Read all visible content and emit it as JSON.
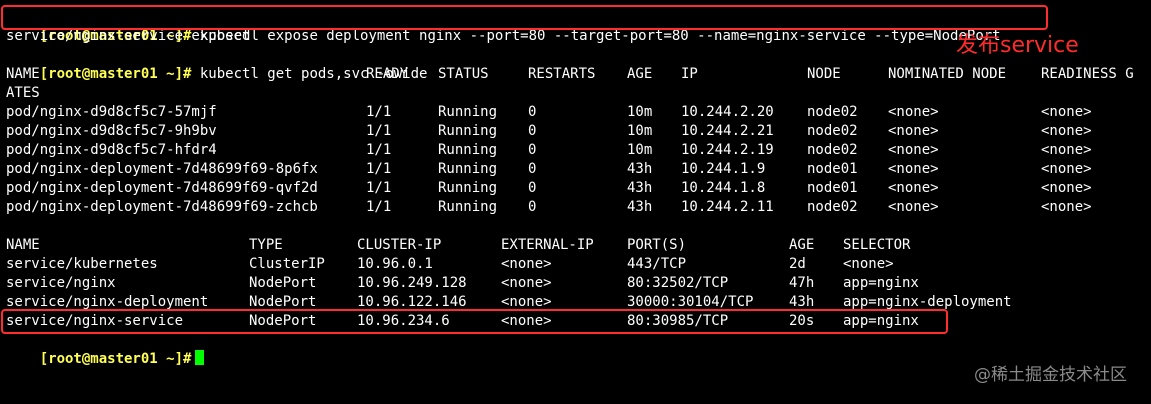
{
  "prompt": "[root@master01 ~]#",
  "commands": {
    "expose": "kubectl expose deployment nginx --port=80 --target-port=80 --name=nginx-service --type=NodePort",
    "get": "kubectl get pods,svc -owide"
  },
  "output": {
    "exposed": "service/nginx-service exposed",
    "ates": "ATES"
  },
  "pods": {
    "headers": [
      "NAME",
      "READY",
      "STATUS",
      "RESTARTS",
      "AGE",
      "IP",
      "NODE",
      "NOMINATED NODE",
      "READINESS G"
    ],
    "rows": [
      [
        "pod/nginx-d9d8cf5c7-57mjf",
        "1/1",
        "Running",
        "0",
        "10m",
        "10.244.2.20",
        "node02",
        "<none>",
        "<none>"
      ],
      [
        "pod/nginx-d9d8cf5c7-9h9bv",
        "1/1",
        "Running",
        "0",
        "10m",
        "10.244.2.21",
        "node02",
        "<none>",
        "<none>"
      ],
      [
        "pod/nginx-d9d8cf5c7-hfdr4",
        "1/1",
        "Running",
        "0",
        "10m",
        "10.244.2.19",
        "node02",
        "<none>",
        "<none>"
      ],
      [
        "pod/nginx-deployment-7d48699f69-8p6fx",
        "1/1",
        "Running",
        "0",
        "43h",
        "10.244.1.9",
        "node01",
        "<none>",
        "<none>"
      ],
      [
        "pod/nginx-deployment-7d48699f69-qvf2d",
        "1/1",
        "Running",
        "0",
        "43h",
        "10.244.1.8",
        "node01",
        "<none>",
        "<none>"
      ],
      [
        "pod/nginx-deployment-7d48699f69-zchcb",
        "1/1",
        "Running",
        "0",
        "43h",
        "10.244.2.11",
        "node02",
        "<none>",
        "<none>"
      ]
    ]
  },
  "services": {
    "headers": [
      "NAME",
      "TYPE",
      "CLUSTER-IP",
      "EXTERNAL-IP",
      "PORT(S)",
      "AGE",
      "SELECTOR"
    ],
    "rows": [
      [
        "service/kubernetes",
        "ClusterIP",
        "10.96.0.1",
        "<none>",
        "443/TCP",
        "2d",
        "<none>"
      ],
      [
        "service/nginx",
        "NodePort",
        "10.96.249.128",
        "<none>",
        "80:32502/TCP",
        "47h",
        "app=nginx"
      ],
      [
        "service/nginx-deployment",
        "NodePort",
        "10.96.122.146",
        "<none>",
        "30000:30104/TCP",
        "43h",
        "app=nginx-deployment"
      ],
      [
        "service/nginx-service",
        "NodePort",
        "10.96.234.6",
        "<none>",
        "80:30985/TCP",
        "20s",
        "app=nginx"
      ]
    ]
  },
  "annotation": "发布service",
  "watermark": "@稀土掘金技术社区",
  "colors": {
    "background": "#000000",
    "prompt": "#ffff54",
    "text": "#ffffff",
    "cursor": "#00ff00",
    "highlight": "#ff2d2d"
  }
}
